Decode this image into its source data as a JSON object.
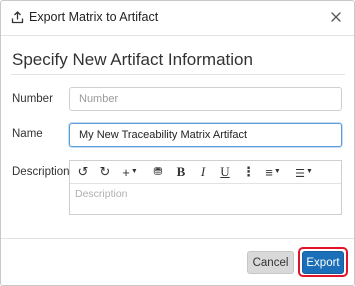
{
  "dialog": {
    "title": "Export Matrix to Artifact",
    "icons": {
      "title": "export-icon",
      "close": "close-icon"
    }
  },
  "form": {
    "heading": "Specify New Artifact Information",
    "number": {
      "label": "Number",
      "value": "",
      "placeholder": "Number"
    },
    "name": {
      "label": "Name",
      "value": "My New Traceability Matrix Artifact",
      "placeholder": ""
    },
    "description": {
      "label": "Description",
      "placeholder": "Description",
      "toolbar": [
        {
          "name": "undo-icon",
          "glyph": "↺"
        },
        {
          "name": "redo-icon",
          "glyph": "↻"
        },
        {
          "name": "insert-icon",
          "glyph": "+"
        },
        {
          "name": "stamp-icon",
          "glyph": "⛃"
        },
        {
          "name": "bold-icon",
          "glyph": "B"
        },
        {
          "name": "italic-icon",
          "glyph": "I"
        },
        {
          "name": "underline-icon",
          "glyph": "U"
        },
        {
          "name": "more-icon",
          "glyph": "⋮"
        },
        {
          "name": "align-icon",
          "glyph": "≡"
        },
        {
          "name": "list-icon",
          "glyph": "☰"
        }
      ]
    }
  },
  "footer": {
    "cancel_label": "Cancel",
    "export_label": "Export"
  },
  "colors": {
    "primary": "#1a6fb8",
    "highlight_outline": "#e1132b",
    "focus_border": "#5b9dd9",
    "cancel_bg": "#d9d9d9"
  }
}
